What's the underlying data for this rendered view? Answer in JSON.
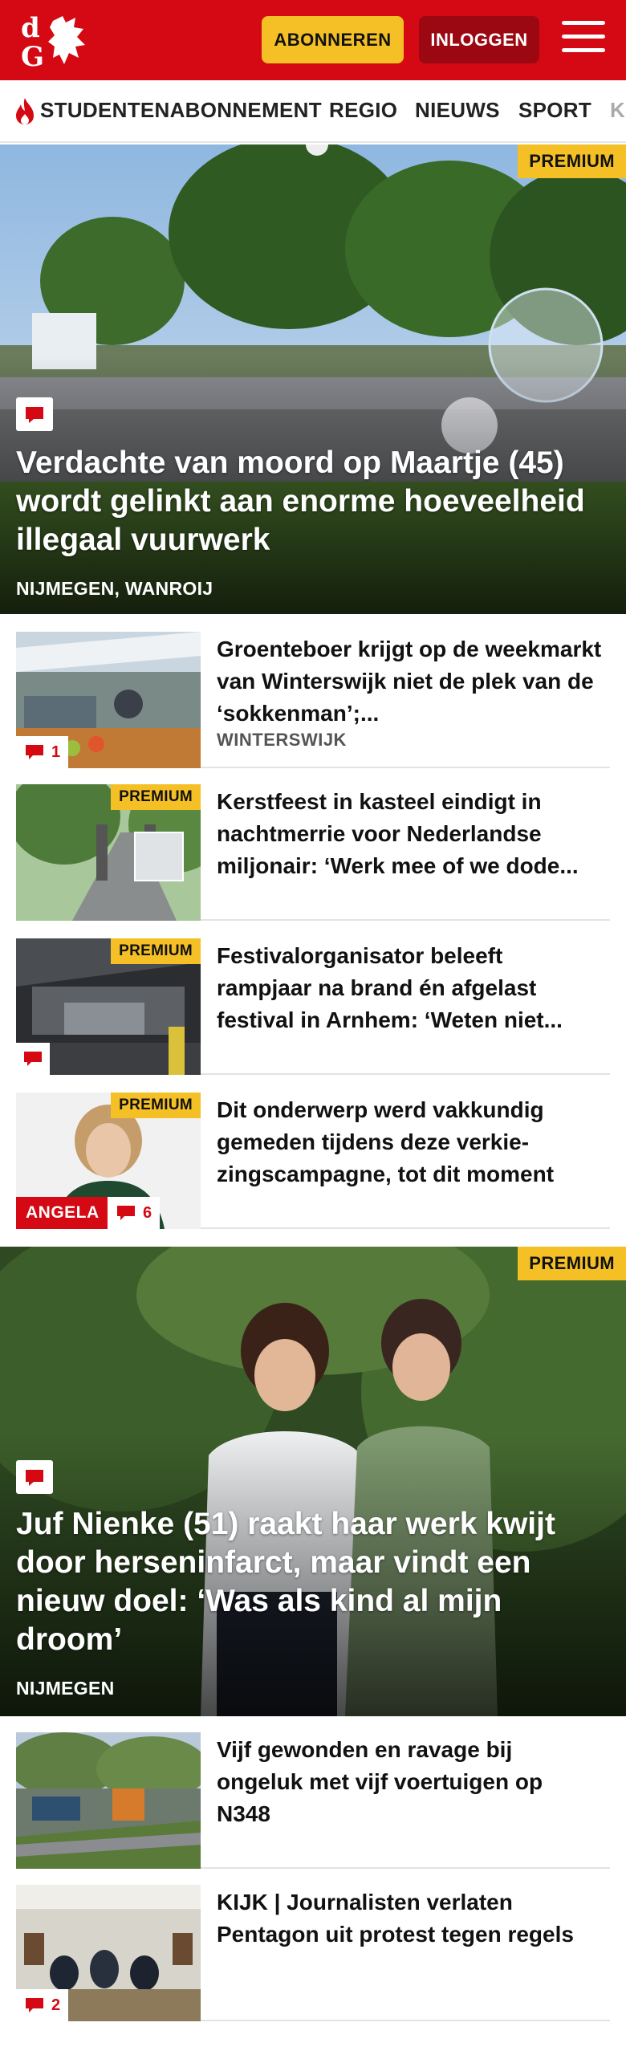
{
  "header": {
    "subscribe_label": "ABONNEREN",
    "login_label": "INLOGGEN",
    "brand_color": "#d40913",
    "accent_color": "#f4c025"
  },
  "nav": {
    "items": [
      "STUDENTENABONNEMENT",
      "REGIO",
      "NIEUWS",
      "SPORT",
      "K"
    ]
  },
  "hero1": {
    "premium": "PREMIUM",
    "title": "Verdachte van moord op Maartje (45) wordt gelinkt aan enorme hoeveel­heid illegaal vuurwerk",
    "location": "NIJMEGEN, WANROIJ"
  },
  "articles1": [
    {
      "title": "Groenteboer krijgt op de weekmarkt van Winterswijk niet de plek van de ‘sokkenman’;...",
      "location": "WINTERSWIJK",
      "comments": "1",
      "premium": ""
    },
    {
      "title": "Kerstfeest in kasteel eindigt in nachtmerrie voor Nederlandse miljonair: ‘Werk mee of we dode...",
      "location": "",
      "comments": "",
      "premium": "PREMIUM"
    },
    {
      "title": "Festivalorganisator beleeft rampjaar na brand én afgelast festival in Arnhem: ‘Weten niet...",
      "location": "",
      "comments": "",
      "premium": "PREMIUM"
    },
    {
      "title": "Dit onderwerp werd vakkundig gemeden tijdens deze verkie­zingscampagne, tot dit moment",
      "location": "",
      "comments": "6",
      "premium": "PREMIUM",
      "tag": "ANGELA"
    }
  ],
  "hero2": {
    "premium": "PREMIUM",
    "title": "Juf Nienke (51) raakt haar werk kwijt door herseninfarct, maar vindt een nieuw doel: ‘Was als kind al mijn droom’",
    "location": "NIJMEGEN"
  },
  "articles2": [
    {
      "title": "Vijf gewonden en ravage bij ongeluk met vijf voertuigen op N348",
      "comments": ""
    },
    {
      "title": "KIJK | Journalisten verlaten Pentagon uit protest tegen regels",
      "comments": "2"
    }
  ]
}
